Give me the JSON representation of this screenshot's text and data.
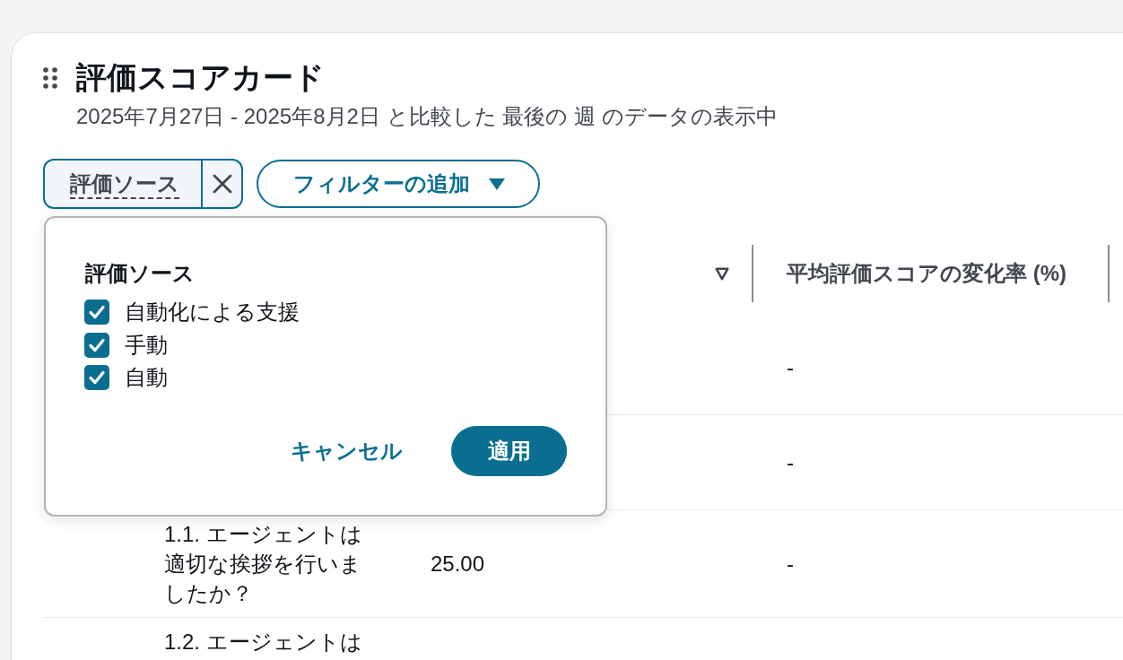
{
  "scorecard": {
    "title": "評価スコアカード",
    "subtitle": "2025年7月27日 - 2025年8月2日 と比較した 最後の 週 のデータの表示中",
    "filter_tokens": [
      {
        "label": "評価ソース"
      }
    ],
    "add_filter_button": "フィルターの追加",
    "filter_popover": {
      "title": "評価ソース",
      "options": [
        {
          "label": "自動化による支援",
          "checked": true
        },
        {
          "label": "手動",
          "checked": true
        },
        {
          "label": "自動",
          "checked": true
        }
      ],
      "cancel_button": "キャンセル",
      "apply_button": "適用"
    },
    "table": {
      "column_2": {
        "sortable": true
      },
      "change_rate": {
        "label": "平均評価スコアの変化率 (%)",
        "sortable": false
      },
      "rows": [
        {
          "change_rate": "-"
        },
        {
          "change_rate": "-",
          "children": [
            {
              "column_1": "1.1. エージェントは適切な挨拶を行いましたか？",
              "column_2": "25.00",
              "change_rate": "-"
            },
            {
              "column_1": "1.2. エージェントは"
            }
          ]
        }
      ]
    }
  }
}
